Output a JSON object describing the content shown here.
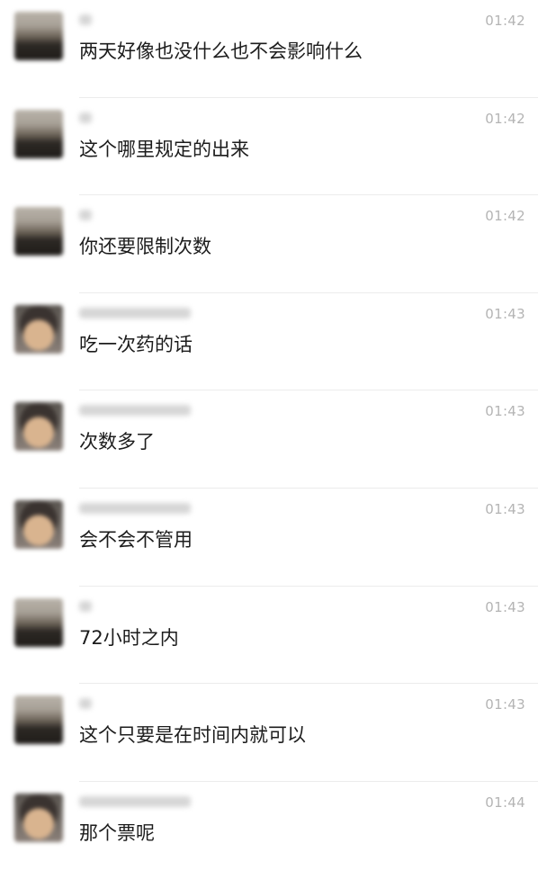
{
  "messages": [
    {
      "avatar": "landscape-avatar",
      "time": "01:42",
      "text": "两天好像也没什么也不会影响什么"
    },
    {
      "avatar": "landscape-avatar",
      "time": "01:42",
      "text": "这个哪里规定的出来"
    },
    {
      "avatar": "landscape-avatar",
      "time": "01:42",
      "text": "你还要限制次数"
    },
    {
      "avatar": "portrait-avatar",
      "time": "01:43",
      "text": "吃一次药的话"
    },
    {
      "avatar": "portrait-avatar",
      "time": "01:43",
      "text": "次数多了"
    },
    {
      "avatar": "portrait-avatar",
      "time": "01:43",
      "text": "会不会不管用"
    },
    {
      "avatar": "landscape-avatar",
      "time": "01:43",
      "text": "72小时之内"
    },
    {
      "avatar": "landscape-avatar",
      "time": "01:43",
      "text": "这个只要是在时间内就可以"
    },
    {
      "avatar": "portrait-avatar",
      "time": "01:44",
      "text": "那个票呢"
    }
  ]
}
